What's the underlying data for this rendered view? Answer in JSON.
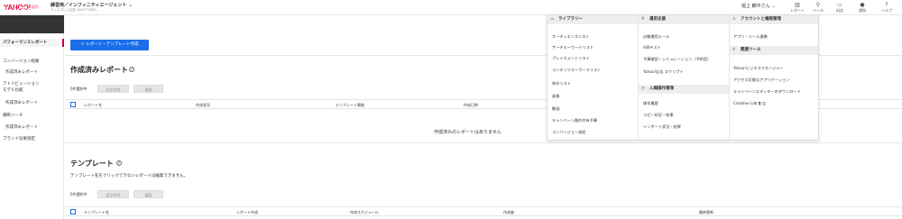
{
  "header": {
    "logo": "YAHOO!",
    "logo_sub": "広告",
    "account_name": "練習用／インフィニティエージェント",
    "account_id": "ディスプレイ広告 1001774851",
    "user_name": "堀上 麟平さん",
    "nav": [
      {
        "label": "レポート",
        "icon": "bar-chart-icon"
      },
      {
        "label": "ツール",
        "icon": "wrench-icon"
      },
      {
        "label": "料金",
        "icon": "yen-icon"
      },
      {
        "label": "通知",
        "icon": "bell-icon"
      },
      {
        "label": "ヘルプ",
        "icon": "help-icon"
      }
    ]
  },
  "sidebar": {
    "back_icon": "back-arrow-icon",
    "title": "レポート",
    "items": [
      {
        "label": "パフォーマンスレポート",
        "active": true
      },
      {
        "label": "コンバージョン経路"
      },
      {
        "label": "作成済みレポート"
      },
      {
        "label": "アトリビューション"
      },
      {
        "label": "モデル比較"
      },
      {
        "label": "作成済みレポート"
      },
      {
        "label": "横断リーチ"
      },
      {
        "label": "作成済みレポート"
      },
      {
        "label": "ブランド効果測定"
      }
    ]
  },
  "main": {
    "create_button": "＋ レポート・テンプレート作成",
    "created_reports": {
      "title": "作成済みレポート",
      "selected": "0件選択中",
      "delete_btn": "設定削除",
      "copy_btn": "複製",
      "columns": [
        "レポート名",
        "作成状況",
        "テンプレート情報",
        "作成日時"
      ],
      "empty": "作成済みのレポートはありません"
    },
    "templates": {
      "title": "テンプレート",
      "note": "テンプレート名をクリックできないレポートは編集できません。",
      "selected": "0件選択中",
      "delete_btn": "設定削除",
      "copy_btn": "複製",
      "columns": [
        "テンプレート名",
        "レポート作成",
        "作成スケジュール",
        "作成者",
        "最終更新"
      ]
    }
  },
  "menu": {
    "col1": {
      "heading": "ライブラリー",
      "items": [
        "オーディエンスリスト",
        "サーチキーワードリスト",
        "プレイスメントリスト",
        "コンテンツキーワードリスト",
        "除外リスト",
        "画像",
        "動画",
        "キャンペーン間の共有予算",
        "コンバージョン測定"
      ]
    },
    "col2": {
      "heading": "運用支援",
      "items": [
        "自動運用ルール",
        "A/Bテスト",
        "予算確認・シミュレーション（予約型）",
        "Yahoo!広告 スクリプト"
      ],
      "heading2": "入稿操作管理",
      "items2": [
        "操作履歴",
        "コピー状況・結果",
        "インポート状況・結果"
      ]
    },
    "col3": {
      "heading": "アカウントと権限管理",
      "items": [
        "アプリ・ツール連携"
      ],
      "heading2": "関連ツール",
      "items2": [
        "Yahoo!ビジネスマネージャー",
        "アクセス可能なアプリケーション",
        "キャンペーンエディターのダウンロード",
        "Creative Lab"
      ]
    }
  },
  "colors": {
    "primary": "#1a6ee8",
    "brand": "#e60033",
    "active_marker": "#c4002b"
  }
}
